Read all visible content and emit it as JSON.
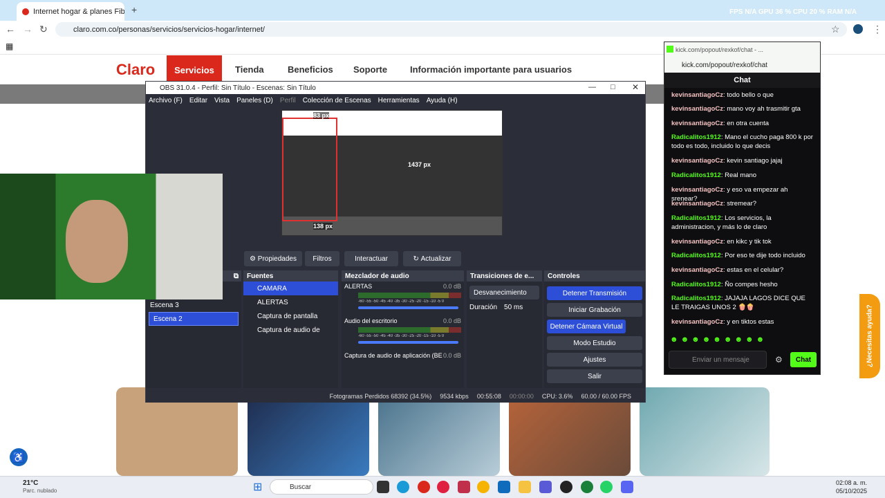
{
  "browser": {
    "tab_title": "Internet hogar & planes Fibra C",
    "url": "claro.com.co/personas/servicios/servicios-hogar/internet/",
    "perf": "FPS N/A   GPU 36 %   CPU 20 %   RAM N/A"
  },
  "claro": {
    "logo": "Claro",
    "nav": [
      "Servicios",
      "Tienda",
      "Beneficios",
      "Soporte",
      "Información importante para usuarios"
    ]
  },
  "obs": {
    "title": "OBS 31.0.4 - Perfil: Sin Título - Escenas: Sin Título",
    "menu": [
      "Archivo (F)",
      "Editar",
      "Vista",
      "Paneles (D)",
      "Perfil",
      "Colección de Escenas",
      "Herramientas",
      "Ayuda (H)"
    ],
    "preview_labels": [
      "83 px",
      "1437 px",
      "138 px"
    ],
    "buttons": [
      "Propiedades",
      "Filtros",
      "Interactuar",
      "Actualizar"
    ],
    "docks": {
      "scenes": [
        "Escena 3",
        "Escena 2"
      ],
      "sources_title": "Fuentes",
      "sources": [
        "CAMARA",
        "ALERTAS",
        "Captura de pantalla",
        "Captura de audio de"
      ],
      "mixer_title": "Mezclador de audio",
      "mixer": [
        {
          "name": "ALERTAS",
          "db": "0.0 dB"
        },
        {
          "name": "Audio del escritorio",
          "db": "0.0 dB"
        },
        {
          "name": "Captura de audio de aplicación (BE",
          "db": "0.0 dB"
        }
      ],
      "meter_scale": "-60 -55 -50 -45 -40 -35 -30 -25 -20 -15 -10 -5 0",
      "transitions_title": "Transiciones de e...",
      "transition": "Desvanecimiento",
      "duration_label": "Duración",
      "duration": "50 ms",
      "controls_title": "Controles",
      "controls": [
        "Detener Transmisión",
        "Iniciar Grabación",
        "Detener Cámara Virtual",
        "Modo Estudio",
        "Ajustes",
        "Salir"
      ]
    },
    "status": {
      "frames": "Fotogramas Perdidos 68392 (34.5%)",
      "kbps": "9534 kbps",
      "live": "00:55:08",
      "rec": "00:00:00",
      "cpu": "CPU: 3.6%",
      "fps": "60.00 / 60.00 FPS"
    }
  },
  "kick": {
    "title": "kick.com/popout/rexkof/chat - ...",
    "url": "kick.com/popout/rexkof/chat",
    "header": "Chat",
    "messages": [
      {
        "user": "kevinsantiagoCz",
        "text": "todo bello o que",
        "c": "u1"
      },
      {
        "user": "kevinsantiagoCz",
        "text": "mano voy ah trasmitir gta",
        "c": "u1"
      },
      {
        "user": "kevinsantiagoCz",
        "text": "en otra cuenta",
        "c": "u1"
      },
      {
        "user": "Radicalitos1912",
        "text": "Mano el cucho paga 800 k por todo es todo, incluido lo que decis",
        "c": "u2"
      },
      {
        "user": "kevinsantiagoCz",
        "text": "kevin santiago jajaj",
        "c": "u1"
      },
      {
        "user": "Radicalitos1912",
        "text": "Real mano",
        "c": "u2"
      },
      {
        "user": "kevinsantiagoCz",
        "text": "y eso va empezar ah srenear?",
        "c": "u1"
      },
      {
        "user": "kevinsantiagoCz",
        "text": "stremear?",
        "c": "u1"
      },
      {
        "user": "Radicalitos1912",
        "text": "Los servicios, la administracion, y más lo de claro",
        "c": "u2"
      },
      {
        "user": "kevinsantiagoCz",
        "text": "en kikc y tik tok",
        "c": "u1"
      },
      {
        "user": "Radicalitos1912",
        "text": "Por eso te dije todo incluido",
        "c": "u2"
      },
      {
        "user": "kevinsantiagoCz",
        "text": "estas en el celular?",
        "c": "u1"
      },
      {
        "user": "Radicalitos1912",
        "text": "Ño compes hesho",
        "c": "u2"
      },
      {
        "user": "Radicalitos1912",
        "text": "JAJAJA LAGOS DICE QUE LE TRAIGAS UNOS 2 🍿🍿",
        "c": "u2"
      },
      {
        "user": "kevinsantiagoCz",
        "text": "y en tiktos estas",
        "c": "u1"
      }
    ],
    "placeholder": "Enviar un mensaje",
    "chat_btn": "Chat"
  },
  "help": "¿Necesitas ayuda?",
  "taskbar": {
    "temp": "21°C",
    "weather": "Parc. nublado",
    "search": "Buscar",
    "time": "02:08 a. m.",
    "date": "05/10/2025"
  }
}
